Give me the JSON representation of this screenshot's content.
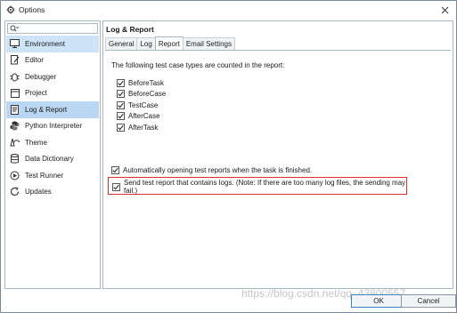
{
  "window": {
    "title": "Options",
    "close_icon": "close-icon"
  },
  "search": {
    "placeholder": ""
  },
  "sidebar": {
    "items": [
      {
        "label": "Environment",
        "icon": "monitor-icon"
      },
      {
        "label": "Editor",
        "icon": "editor-icon"
      },
      {
        "label": "Debugger",
        "icon": "debugger-icon"
      },
      {
        "label": "Project",
        "icon": "project-icon"
      },
      {
        "label": "Log & Report",
        "icon": "log-report-icon"
      },
      {
        "label": "Python Interpreter",
        "icon": "python-icon"
      },
      {
        "label": "Theme",
        "icon": "theme-icon"
      },
      {
        "label": "Data Dictionary",
        "icon": "database-icon"
      },
      {
        "label": "Test Runner",
        "icon": "test-runner-icon"
      },
      {
        "label": "Updates",
        "icon": "updates-icon"
      }
    ]
  },
  "main": {
    "section_title": "Log & Report",
    "tabs": [
      {
        "label": "General"
      },
      {
        "label": "Log"
      },
      {
        "label": "Report"
      },
      {
        "label": "Email Settings"
      }
    ],
    "active_tab": "Report",
    "intro": "The following test case types are counted in the report:",
    "case_types": [
      {
        "label": "BeforeTask",
        "checked": true
      },
      {
        "label": "BeforeCase",
        "checked": true
      },
      {
        "label": "TestCase",
        "checked": true
      },
      {
        "label": "AfterCase",
        "checked": true
      },
      {
        "label": "AfterTask",
        "checked": true
      }
    ],
    "auto_open": {
      "label": "Automatically opening test reports when the task is finished.",
      "checked": true
    },
    "send_logs": {
      "label": "Send test report that contains logs. (Note: If there are too many log files, the sending may fail.)",
      "checked": true
    }
  },
  "buttons": {
    "ok": "OK",
    "cancel": "Cancel"
  },
  "watermark": "https://blog.csdn.net/qq_43800557",
  "colors": {
    "selected_bg": "#cde3f7",
    "highlight_border": "#e03030"
  }
}
